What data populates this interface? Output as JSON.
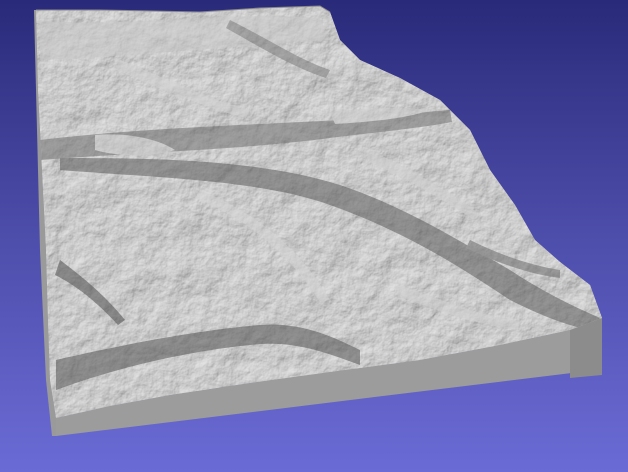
{
  "viewer": {
    "background_top_color": "#2a2a7a",
    "background_bottom_color": "#6b6bd6",
    "model": {
      "type": "3d-terrain-relief",
      "surface_color": "#a9a9a9",
      "side_color": "#9b9b9b"
    }
  }
}
